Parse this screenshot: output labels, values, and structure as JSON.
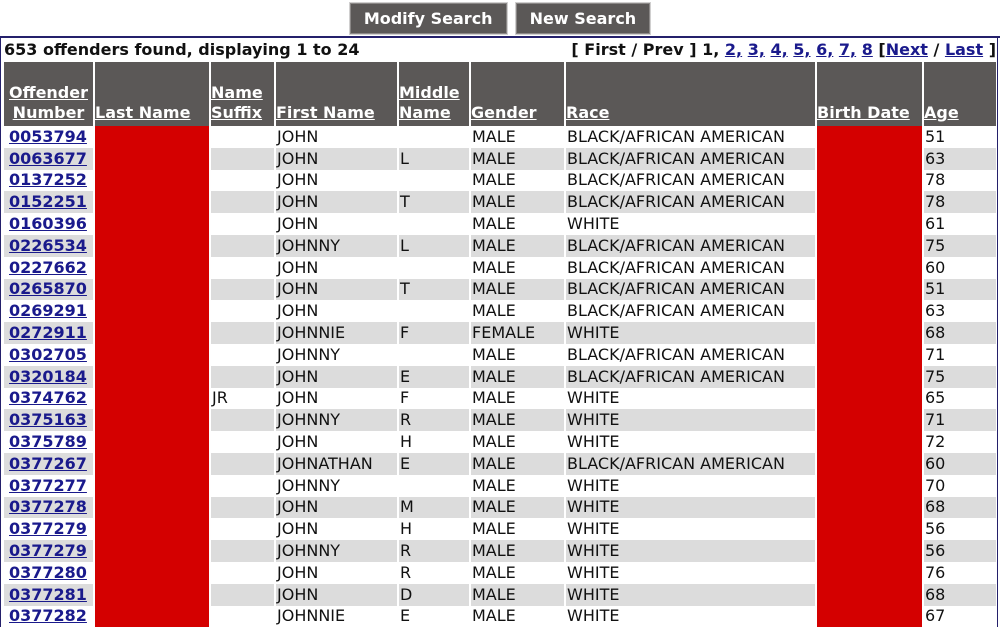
{
  "buttons": {
    "modify": "Modify Search",
    "new": "New Search"
  },
  "summary": "653 offenders found, displaying 1 to 24",
  "pager": {
    "open": "[ First / Prev ]",
    "current": "1,",
    "pages": [
      "2,",
      "3,",
      "4,",
      "5,",
      "6,",
      "7,",
      "8"
    ],
    "next": "Next",
    "sep": "/",
    "last": "Last",
    "close": "]",
    "open_br": "["
  },
  "table": {
    "headers": {
      "num_1": "Offender",
      "num_2": "Number",
      "last": "Last Name",
      "suf_1": "Name",
      "suf_2": "Suffix",
      "first": "First Name",
      "mid_1": "Middle",
      "mid_2": "Name",
      "gender": "Gender",
      "race": "Race",
      "birth": "Birth Date",
      "age": "Age"
    },
    "redaction_color": "#d40000",
    "rows": [
      {
        "num": "0053794",
        "suf": "",
        "first": "JOHN",
        "mid": "",
        "gender": "MALE",
        "race": "BLACK/AFRICAN AMERICAN",
        "age": "51"
      },
      {
        "num": "0063677",
        "suf": "",
        "first": "JOHN",
        "mid": "L",
        "gender": "MALE",
        "race": "BLACK/AFRICAN AMERICAN",
        "age": "63"
      },
      {
        "num": "0137252",
        "suf": "",
        "first": "JOHN",
        "mid": "",
        "gender": "MALE",
        "race": "BLACK/AFRICAN AMERICAN",
        "age": "78"
      },
      {
        "num": "0152251",
        "suf": "",
        "first": "JOHN",
        "mid": "T",
        "gender": "MALE",
        "race": "BLACK/AFRICAN AMERICAN",
        "age": "78"
      },
      {
        "num": "0160396",
        "suf": "",
        "first": "JOHN",
        "mid": "",
        "gender": "MALE",
        "race": "WHITE",
        "age": "61"
      },
      {
        "num": "0226534",
        "suf": "",
        "first": "JOHNNY",
        "mid": "L",
        "gender": "MALE",
        "race": "BLACK/AFRICAN AMERICAN",
        "age": "75"
      },
      {
        "num": "0227662",
        "suf": "",
        "first": "JOHN",
        "mid": "",
        "gender": "MALE",
        "race": "BLACK/AFRICAN AMERICAN",
        "age": "60"
      },
      {
        "num": "0265870",
        "suf": "",
        "first": "JOHN",
        "mid": "T",
        "gender": "MALE",
        "race": "BLACK/AFRICAN AMERICAN",
        "age": "51"
      },
      {
        "num": "0269291",
        "suf": "",
        "first": "JOHN",
        "mid": "",
        "gender": "MALE",
        "race": "BLACK/AFRICAN AMERICAN",
        "age": "63"
      },
      {
        "num": "0272911",
        "suf": "",
        "first": "JOHNNIE",
        "mid": "F",
        "gender": "FEMALE",
        "race": "WHITE",
        "age": "68"
      },
      {
        "num": "0302705",
        "suf": "",
        "first": "JOHNNY",
        "mid": "",
        "gender": "MALE",
        "race": "BLACK/AFRICAN AMERICAN",
        "age": "71"
      },
      {
        "num": "0320184",
        "suf": "",
        "first": "JOHN",
        "mid": "E",
        "gender": "MALE",
        "race": "BLACK/AFRICAN AMERICAN",
        "age": "75"
      },
      {
        "num": "0374762",
        "suf": "JR",
        "first": "JOHN",
        "mid": "F",
        "gender": "MALE",
        "race": "WHITE",
        "age": "65"
      },
      {
        "num": "0375163",
        "suf": "",
        "first": "JOHNNY",
        "mid": "R",
        "gender": "MALE",
        "race": "WHITE",
        "age": "71"
      },
      {
        "num": "0375789",
        "suf": "",
        "first": "JOHN",
        "mid": "H",
        "gender": "MALE",
        "race": "WHITE",
        "age": "72"
      },
      {
        "num": "0377267",
        "suf": "",
        "first": "JOHNATHAN",
        "mid": "E",
        "gender": "MALE",
        "race": "BLACK/AFRICAN AMERICAN",
        "age": "60"
      },
      {
        "num": "0377277",
        "suf": "",
        "first": "JOHNNY",
        "mid": "",
        "gender": "MALE",
        "race": "WHITE",
        "age": "70"
      },
      {
        "num": "0377278",
        "suf": "",
        "first": "JOHN",
        "mid": "M",
        "gender": "MALE",
        "race": "WHITE",
        "age": "68"
      },
      {
        "num": "0377279",
        "suf": "",
        "first": "JOHN",
        "mid": "H",
        "gender": "MALE",
        "race": "WHITE",
        "age": "56"
      },
      {
        "num": "0377279",
        "suf": "",
        "first": "JOHNNY",
        "mid": "R",
        "gender": "MALE",
        "race": "WHITE",
        "age": "56"
      },
      {
        "num": "0377280",
        "suf": "",
        "first": "JOHN",
        "mid": "R",
        "gender": "MALE",
        "race": "WHITE",
        "age": "76"
      },
      {
        "num": "0377281",
        "suf": "",
        "first": "JOHN",
        "mid": "D",
        "gender": "MALE",
        "race": "WHITE",
        "age": "68"
      },
      {
        "num": "0377282",
        "suf": "",
        "first": "JOHNNIE",
        "mid": "E",
        "gender": "MALE",
        "race": "WHITE",
        "age": "67"
      }
    ]
  }
}
